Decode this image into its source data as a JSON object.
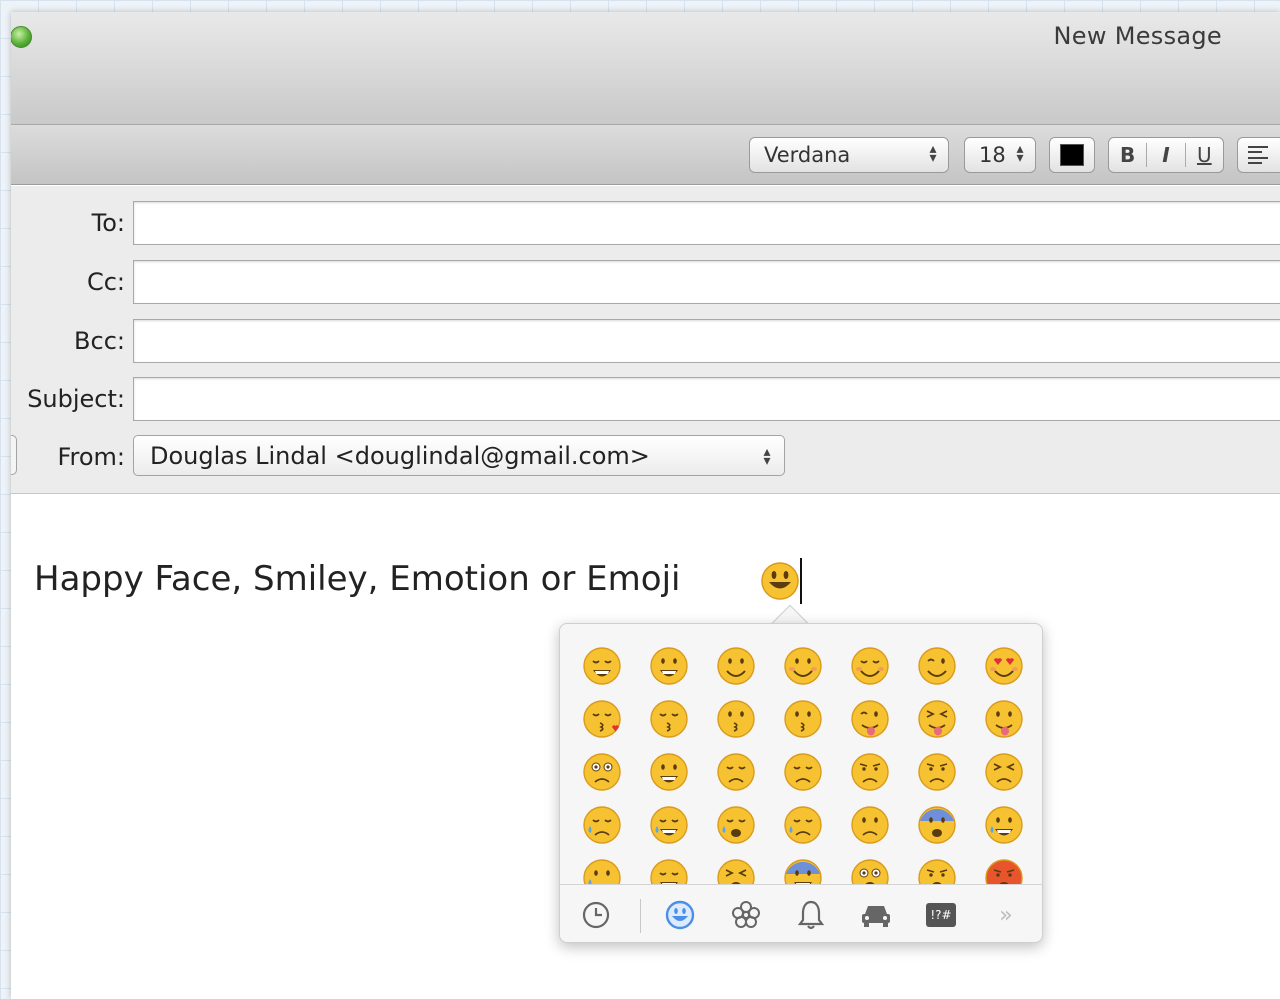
{
  "window": {
    "title": "New Message"
  },
  "format_bar": {
    "font": "Verdana",
    "size": "18",
    "text_color": "#000000",
    "bold_label": "B",
    "italic_label": "I",
    "underline_label": "U"
  },
  "headers": {
    "to_label": "To:",
    "cc_label": "Cc:",
    "bcc_label": "Bcc:",
    "subject_label": "Subject:",
    "from_label": "From:",
    "from_value": "Douglas Lindal <douglindal@gmail.com>"
  },
  "body": {
    "text": "Happy Face, Smiley, Emotion or Emoji"
  },
  "emoji_picker": {
    "rows": 5,
    "columns": 7,
    "tabs": [
      "clock-icon",
      "smiley-icon",
      "flower-icon",
      "bell-icon",
      "car-icon",
      "symbols-icon",
      "more-icon"
    ],
    "selected_tab": "smiley-icon",
    "symbols_label": "!?#",
    "more_label": "»"
  },
  "colors": {
    "emoji_yellow": "#f6c232",
    "emoji_outline": "#d99b1c",
    "tab_active": "#4a8fe6",
    "tab_inactive": "#666666"
  }
}
